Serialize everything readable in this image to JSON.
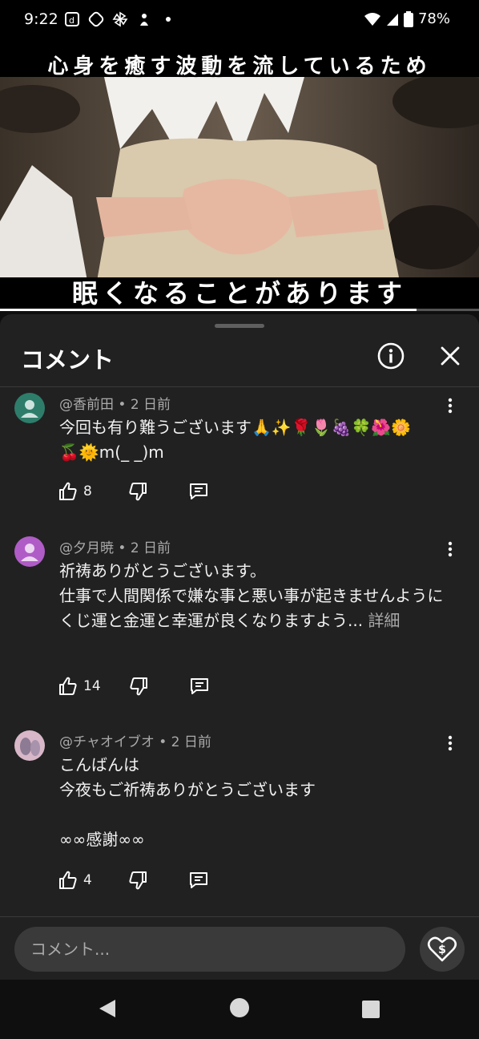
{
  "status_bar": {
    "time": "9:22",
    "battery": "78%",
    "icons": [
      "notification-d-icon",
      "app-icon-1",
      "pinwheel-icon",
      "app-icon-2",
      "dot-icon",
      "wifi-icon",
      "signal-icon",
      "battery-icon"
    ]
  },
  "video": {
    "caption_top": "心身を癒す波動を流しているため",
    "caption_bottom": "眠くなることがあります",
    "progress": 0.87
  },
  "panel": {
    "title": "コメント"
  },
  "comments": [
    {
      "author": "@香前田",
      "time": "2 日前",
      "meta": "@香前田 • 2 日前",
      "text": "今回も有り難うございます🙏✨🌹🌷🍇🍀🌺🌼\n🍒🌞m(_ _)m",
      "more": "",
      "likes": "8",
      "avatar_color": "#2e7d6b"
    },
    {
      "author": "@夕月暁",
      "time": "2 日前",
      "meta": "@夕月暁 • 2 日前",
      "text": "祈祷ありがとうございます。\n仕事で人間関係で嫌な事と悪い事が起きませんように\nくじ運と金運と幸運が良くなりますよう...",
      "more": "詳細",
      "likes": "14",
      "avatar_color": "#b05cc7"
    },
    {
      "author": "@チャオイブオ",
      "time": "2 日前",
      "meta": "@チャオイブオ • 2 日前",
      "text": "こんばんは\n今夜もご祈祷ありがとうございます\n\n∞∞感謝∞∞",
      "more": "",
      "likes": "4",
      "avatar_color": "#d8b7c8"
    }
  ],
  "composer": {
    "placeholder": "コメント..."
  }
}
